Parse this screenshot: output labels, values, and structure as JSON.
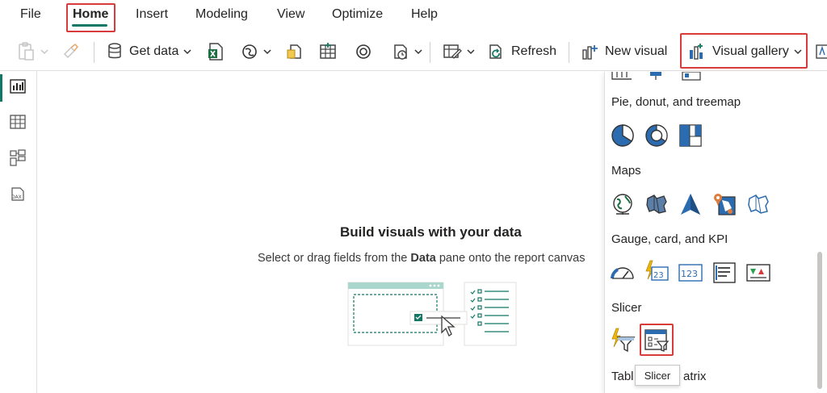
{
  "menu": {
    "file": "File",
    "home": "Home",
    "insert": "Insert",
    "modeling": "Modeling",
    "view": "View",
    "optimize": "Optimize",
    "help": "Help"
  },
  "toolbar": {
    "get_data": "Get data",
    "refresh": "Refresh",
    "new_visual": "New visual",
    "visual_gallery": "Visual gallery"
  },
  "canvas": {
    "title": "Build visuals with your data",
    "subtitle_prefix": "Select or drag fields from the ",
    "subtitle_bold": "Data",
    "subtitle_suffix": " pane onto the report canvas"
  },
  "gallery": {
    "sections": {
      "pie": "Pie, donut, and treemap",
      "maps": "Maps",
      "gauge": "Gauge, card, and KPI",
      "slicer": "Slicer",
      "table_prefix": "Tabl",
      "table_suffix": "atrix"
    },
    "tooltip": "Slicer"
  },
  "colors": {
    "accent": "#117865",
    "highlight": "#d83b3b",
    "icon_blue": "#2b6cb0"
  }
}
